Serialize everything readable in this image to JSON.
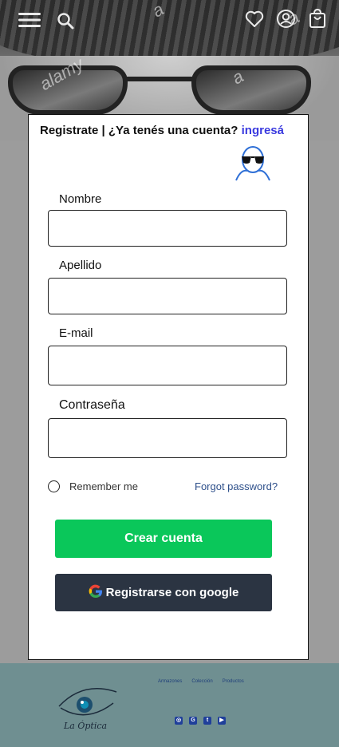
{
  "header": {
    "menu_icon": "hamburger-menu-icon",
    "search_icon": "search-icon",
    "wishlist_icon": "heart-icon",
    "account_icon": "user-circle-icon",
    "cart_icon": "shopping-bag-icon"
  },
  "hero": {
    "watermark": "alamy",
    "watermark_letter": "a"
  },
  "modal": {
    "title": "Registrate | ¿Ya tenés una cuenta?",
    "login_link": "ingresá",
    "avatar_icon": "sunglasses-person-icon",
    "fields": [
      {
        "label": "Nombre",
        "value": ""
      },
      {
        "label": "Apellido",
        "value": ""
      },
      {
        "label": "E-mail",
        "value": ""
      },
      {
        "label": "Contraseña",
        "value": ""
      }
    ],
    "remember_label": "Remember me",
    "forgot_label": "Forgot password?",
    "create_button": "Crear cuenta",
    "google_button": "Registrarse con google"
  },
  "footer": {
    "logo_text": "La Óptica",
    "links": [
      "Armazones",
      "Colección",
      "Productos"
    ],
    "social_icons": [
      "instagram-icon",
      "google-icon",
      "twitter-icon",
      "youtube-icon"
    ]
  },
  "colors": {
    "accent_link": "#3a3adf",
    "create_button": "#0ac75a",
    "google_button": "#2b3442",
    "footer_bg": "#6f8f91"
  }
}
